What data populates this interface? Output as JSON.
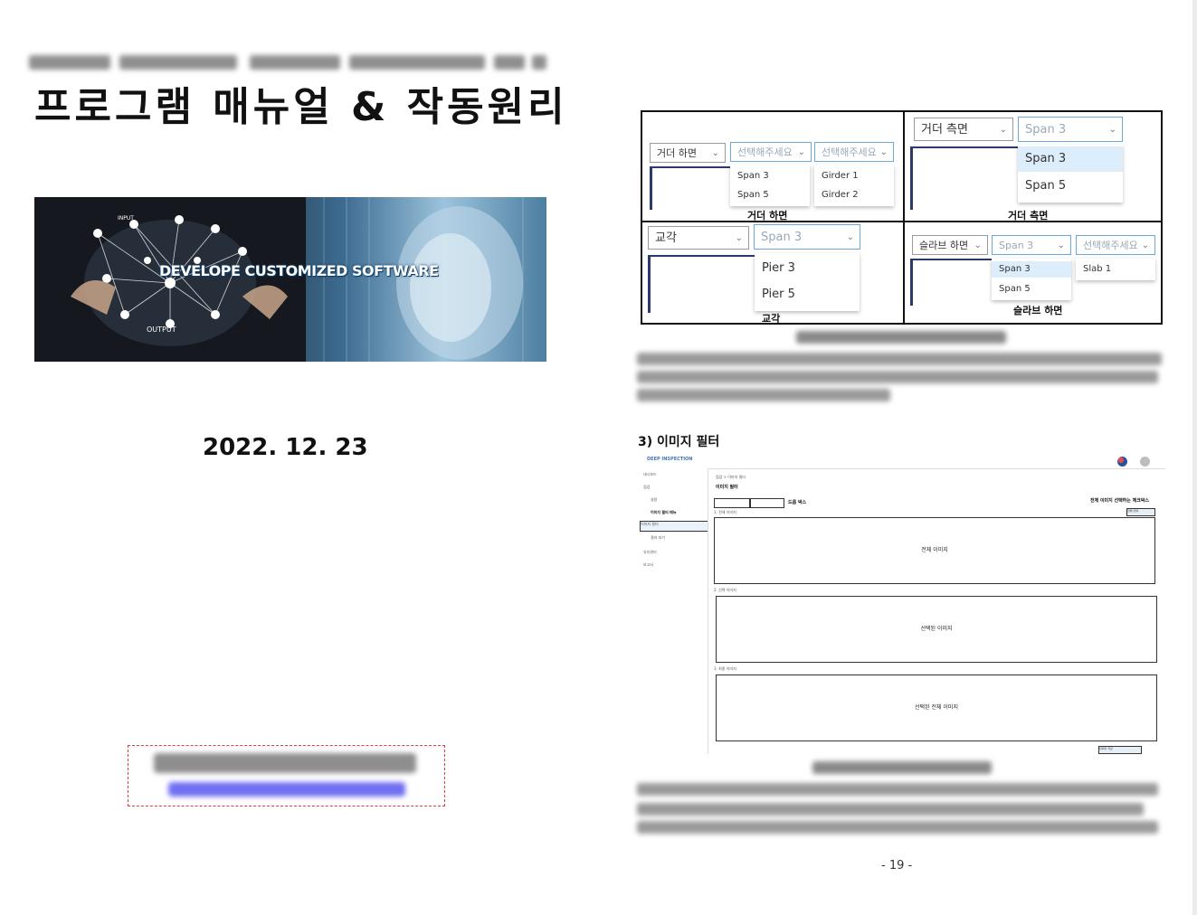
{
  "left_page": {
    "title": "프로그램 매뉴얼 & 작동원리",
    "banner": {
      "headline": "DEVELOPE CUSTOMIZED SOFTWARE",
      "labels": {
        "input": "INPUT",
        "output": "OUTPUT"
      }
    },
    "date": "2022. 12. 23"
  },
  "right_page": {
    "dropdown_panels": [
      {
        "select": "거더 하면",
        "sub1": "선택해주세요",
        "sub2": "선택해주세요",
        "list1": [
          "Span 3",
          "Span 5"
        ],
        "list2": [
          "Girder 1",
          "Girder 2"
        ],
        "caption": "거더 하면"
      },
      {
        "select": "거더 측면",
        "sub1": "Span 3",
        "list1": [
          "Span 3",
          "Span 5"
        ],
        "caption": "거더 측면"
      },
      {
        "select": "교각",
        "sub1": "Span 3",
        "list1": [
          "Pier 3",
          "Pier 5"
        ],
        "caption": "교각"
      },
      {
        "select": "슬라브 하면",
        "sub1": "Span 3",
        "sub2": "선택해주세요",
        "list1": [
          "Span 3",
          "Span 5"
        ],
        "list2": [
          "Slab 1"
        ],
        "caption": "슬라브 하면"
      }
    ],
    "section_heading": "3) 이미지 필터",
    "screenshot": {
      "logo": "DEEP INSPECTION",
      "breadcrumb": "점검 > 이미지 필터",
      "page_title": "이미지 필터",
      "dropdown_box_label": "드롭 박스",
      "checkbox_note": "전체 이미지 선택하는 체크박스",
      "select_all_btn": "전체 선택",
      "sidebar_items": [
        "대시보드",
        "점검",
        "설정",
        "이미지 필터",
        "결과 보기",
        "유지관리",
        "보고서"
      ],
      "hover_label": "이미지 필터 메뉴",
      "boxes": [
        "전체 이미지",
        "선택된 이미지",
        "선택된 전체 이미지"
      ],
      "section_labels": [
        "1. 전체 이미지",
        "2. 선택 이미지",
        "3. 최종 이미지"
      ],
      "save_btn": "이미지 저장"
    },
    "page_number": "- 19 -"
  }
}
